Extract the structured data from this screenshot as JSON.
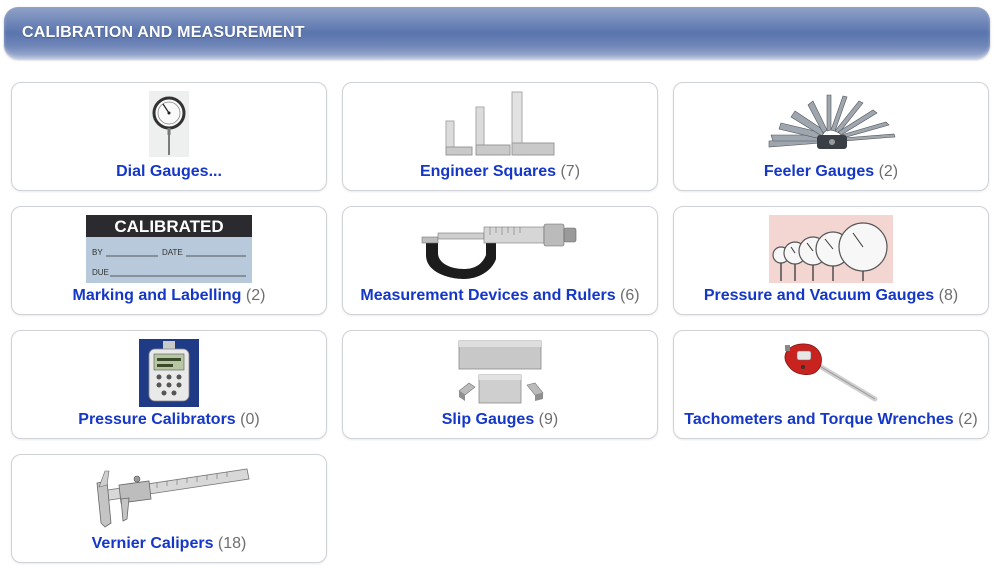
{
  "header": {
    "title": "CALIBRATION AND MEASUREMENT"
  },
  "categories": [
    {
      "name": "Dial Gauges...",
      "count": "",
      "icon": "dial-gauge-icon"
    },
    {
      "name": "Engineer Squares",
      "count": "(7)",
      "icon": "engineer-square-icon"
    },
    {
      "name": "Feeler Gauges",
      "count": "(2)",
      "icon": "feeler-gauge-icon"
    },
    {
      "name": "Marking and Labelling",
      "count": "(2)",
      "icon": "calibrated-label-icon",
      "image_text": {
        "main": "CALIBRATED",
        "by": "BY",
        "date": "DATE",
        "due": "DUE"
      }
    },
    {
      "name": "Measurement Devices and Rulers",
      "count": "(6)",
      "icon": "micrometer-icon"
    },
    {
      "name": "Pressure and Vacuum Gauges",
      "count": "(8)",
      "icon": "pressure-gauges-icon"
    },
    {
      "name": "Pressure Calibrators",
      "count": "(0)",
      "icon": "pressure-calibrator-icon"
    },
    {
      "name": "Slip Gauges",
      "count": "(9)",
      "icon": "slip-gauge-icon"
    },
    {
      "name": "Tachometers and Torque Wrenches",
      "count": "(2)",
      "icon": "torque-wrench-icon"
    },
    {
      "name": "Vernier Calipers",
      "count": "(18)",
      "icon": "vernier-caliper-icon"
    }
  ],
  "colors": {
    "link": "#1537c8",
    "count": "#6e6e6e",
    "header": "#5a74ad"
  }
}
